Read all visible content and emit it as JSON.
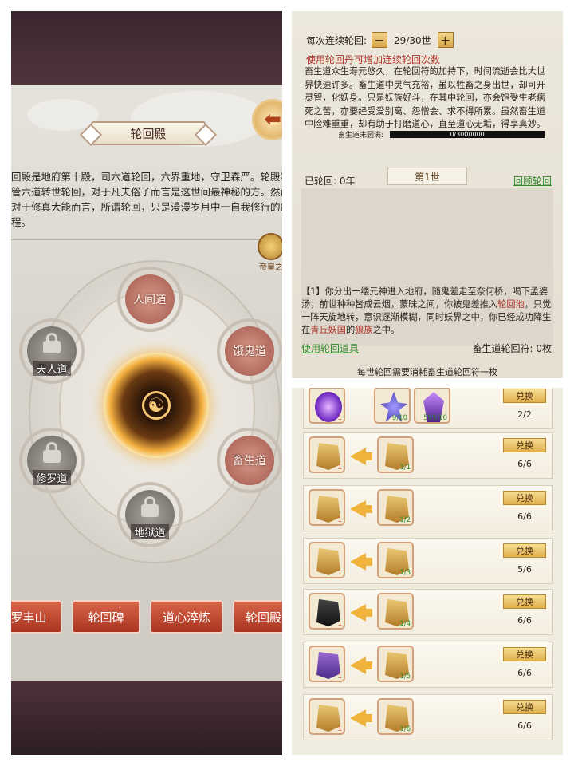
{
  "left": {
    "title": "轮回殿",
    "description": "回殿是地府第十殿，司六道轮回，六界重地，守卫森严。轮殿掌管六道转世轮回，对于凡夫俗子而言是这世间最神秘的方。然而对于修真大能而言，所谓轮回，只是漫漫岁月中一自我修行的旅程。",
    "emperor_label": "帝皇之",
    "paths": [
      {
        "label": "人间道",
        "state": "open"
      },
      {
        "label": "饿鬼道",
        "state": "open"
      },
      {
        "label": "畜生道",
        "state": "open"
      },
      {
        "label": "天人道",
        "state": "locked"
      },
      {
        "label": "修罗道",
        "state": "locked"
      },
      {
        "label": "地狱道",
        "state": "locked"
      }
    ],
    "buttons": [
      "罗丰山",
      "轮回碑",
      "道心淬炼",
      "轮回殿宝"
    ]
  },
  "top_right": {
    "cycle_label": "每次连续轮回:",
    "cycle_value": "29/30世",
    "minus": "−",
    "plus": "+",
    "hint": "使用轮回丹可增加连续轮回次数",
    "paragraph": "畜生道众生寿元悠久，在轮回符的加持下，时间流逝会比大世界快速许多。畜生道中灵气充裕，虽以牲畜之身出世，却可开灵智，化妖身。只是妖族好斗，在其中轮回，亦会饱受生老病死之苦，亦要经受爱别离、怨憎会、求不得所累。虽然畜生道中险难重重，却有助于打磨道心，直至道心无垢，得享真妙。",
    "full_label": "畜生道未圆满:",
    "full_value": "0/3000000",
    "reborn_label": "已轮回: 0年",
    "life_label": "第1世",
    "review_link": "回顾轮回",
    "log_prefix": "【1】你分出一缕元神进入地府，随鬼差走至奈何桥，喝下孟婆汤，前世种种皆成云烟，蒙昧之间，你被鬼差推入",
    "log_hl1": "轮回池",
    "log_mid": "，只觉一阵天旋地转，意识逐渐模糊，同时妖界之中，你已经成功降生在",
    "log_hl2": "青丘妖国",
    "log_mid2": "的",
    "log_hl3": "狼族",
    "log_end": "之中。",
    "use_item": "使用轮回道具",
    "talisman": "畜生道轮回符: 0枚",
    "footnote": "每世轮回需要消耗畜生道轮回符一枚"
  },
  "exchange": {
    "button_label": "兑换",
    "rows": [
      {
        "items": [
          {
            "kind": "orb",
            "count": "1"
          },
          {
            "kind": "plant",
            "count": "9/10"
          },
          {
            "kind": "crystal",
            "count": "595/10"
          }
        ],
        "remaining": "2/2",
        "arrow": false
      },
      {
        "items": [
          {
            "kind": "banner",
            "count": "1"
          },
          {
            "kind": "banner",
            "count": "1/1"
          }
        ],
        "remaining": "6/6",
        "arrow": true
      },
      {
        "items": [
          {
            "kind": "banner",
            "count": "1"
          },
          {
            "kind": "banner",
            "count": "1/2"
          }
        ],
        "remaining": "6/6",
        "arrow": true
      },
      {
        "items": [
          {
            "kind": "banner",
            "count": "1"
          },
          {
            "kind": "banner",
            "count": "1/3"
          }
        ],
        "remaining": "5/6",
        "arrow": true
      },
      {
        "items": [
          {
            "kind": "black",
            "count": "1"
          },
          {
            "kind": "banner",
            "count": "1/4"
          }
        ],
        "remaining": "6/6",
        "arrow": true
      },
      {
        "items": [
          {
            "kind": "purple",
            "count": "1"
          },
          {
            "kind": "banner",
            "count": "1/5"
          }
        ],
        "remaining": "6/6",
        "arrow": true
      },
      {
        "items": [
          {
            "kind": "banner",
            "count": "1"
          },
          {
            "kind": "banner",
            "count": "1/6"
          }
        ],
        "remaining": "6/6",
        "arrow": true
      }
    ]
  }
}
